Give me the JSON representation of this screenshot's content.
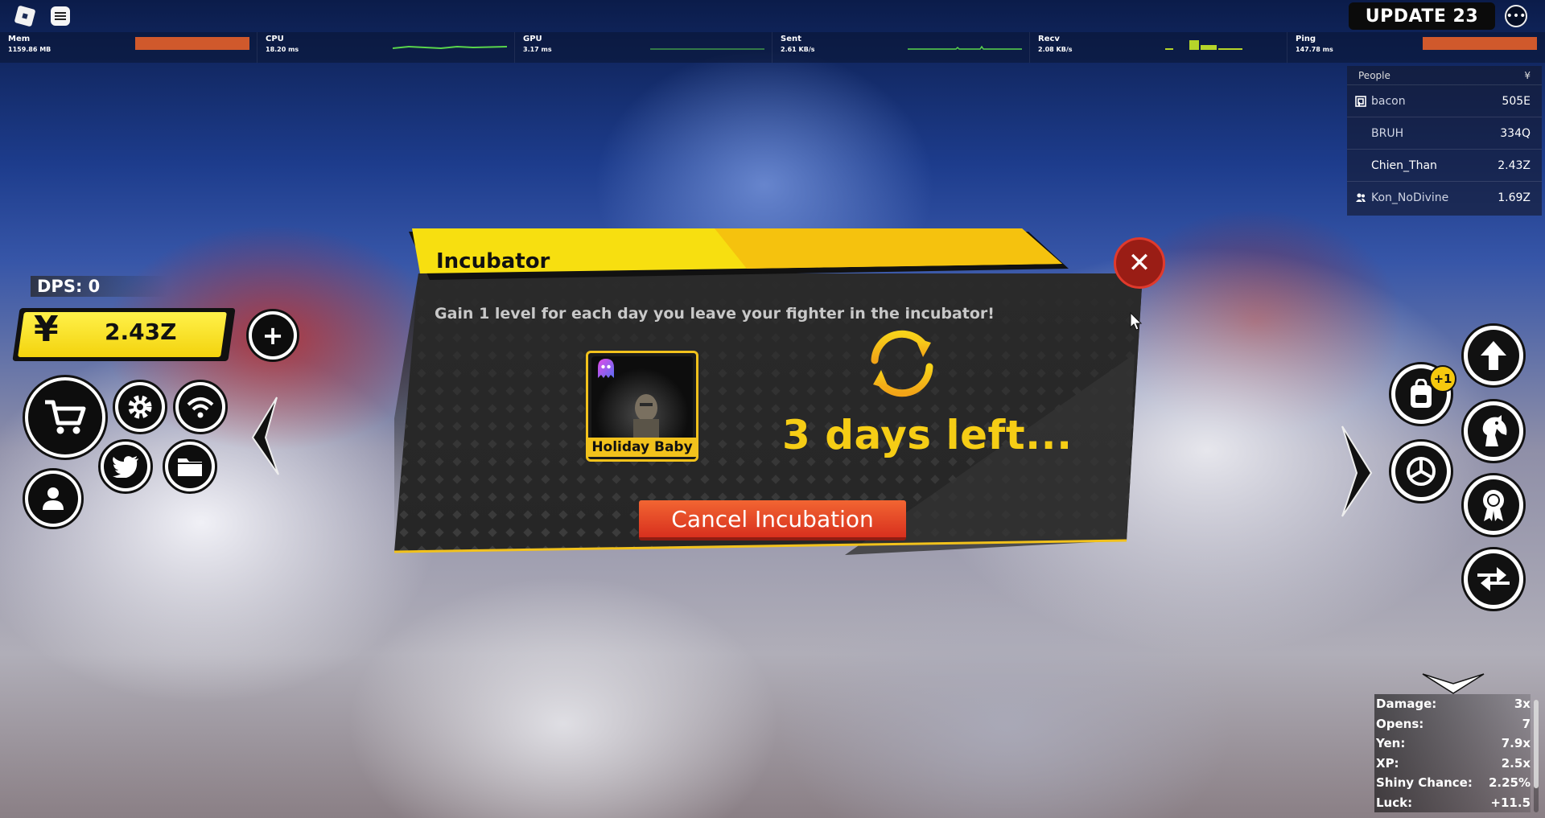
{
  "topbar": {
    "update_label": "UPDATE 23"
  },
  "stats": [
    {
      "label": "Mem",
      "value": "1159.86 MB"
    },
    {
      "label": "CPU",
      "value": "18.20 ms"
    },
    {
      "label": "GPU",
      "value": "3.17 ms"
    },
    {
      "label": "Sent",
      "value": "2.61 KB/s"
    },
    {
      "label": "Recv",
      "value": "2.08 KB/s"
    },
    {
      "label": "Ping",
      "value": "147.78 ms"
    }
  ],
  "leaderboard": {
    "header_people": "People",
    "header_currency": "¥",
    "rows": [
      {
        "name": "bacon",
        "value": "505E"
      },
      {
        "name": "BRUH",
        "value": "334Q"
      },
      {
        "name": "Chien_Than",
        "value": "2.43Z"
      },
      {
        "name": "Kon_NoDivine",
        "value": "1.69Z"
      }
    ]
  },
  "hud": {
    "dps": "DPS: 0",
    "yen_symbol": "¥",
    "yen_value": "2.43Z"
  },
  "modal": {
    "title": "Incubator",
    "subtitle": "Gain 1 level for each day you leave your fighter in the incubator!",
    "fighter_name": "Holiday Baby",
    "days_left": "3 days left...",
    "cancel_label": "Cancel Incubation"
  },
  "notification_badge": "+1",
  "bonuses": [
    {
      "label": "Damage:",
      "value": "3x"
    },
    {
      "label": "Opens:",
      "value": "7"
    },
    {
      "label": "Yen:",
      "value": "7.9x"
    },
    {
      "label": "XP:",
      "value": "2.5x"
    },
    {
      "label": "Shiny Chance:",
      "value": "2.25%"
    },
    {
      "label": "Luck:",
      "value": "+11.5"
    }
  ],
  "colors": {
    "accent_yellow": "#f6cd15",
    "cancel_red": "#e0452a",
    "close_red": "#9a1d15"
  }
}
